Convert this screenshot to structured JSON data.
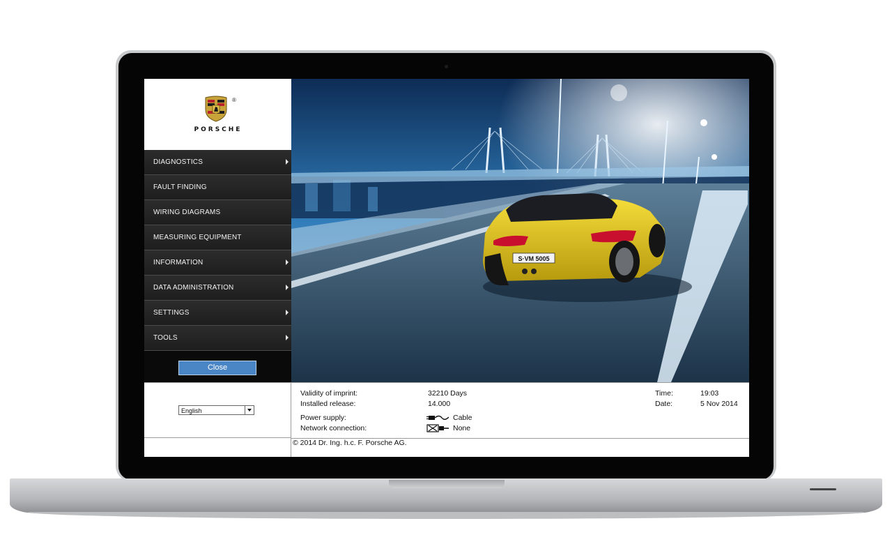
{
  "app": {
    "brand": "PORSCHE",
    "registered_mark": "®"
  },
  "menu": {
    "items": [
      {
        "label": "DIAGNOSTICS",
        "has_submenu": true
      },
      {
        "label": "FAULT FINDING",
        "has_submenu": false
      },
      {
        "label": "WIRING DIAGRAMS",
        "has_submenu": false
      },
      {
        "label": "MEASURING EQUIPMENT",
        "has_submenu": false
      },
      {
        "label": "INFORMATION",
        "has_submenu": true
      },
      {
        "label": "DATA ADMINISTRATION",
        "has_submenu": true
      },
      {
        "label": "SETTINGS",
        "has_submenu": true
      },
      {
        "label": "TOOLS",
        "has_submenu": true
      }
    ],
    "close_label": "Close"
  },
  "language": {
    "selected": "English"
  },
  "status": {
    "validity_label": "Validity of imprint:",
    "validity_value": "32210 Days",
    "release_label": "Installed release:",
    "release_value": "14.000",
    "power_label": "Power supply:",
    "power_value": "Cable",
    "network_label": "Network connection:",
    "network_value": "None",
    "time_label": "Time:",
    "time_value": "19:03",
    "date_label": "Date:",
    "date_value": "5 Nov 2014",
    "copyright": "© 2014 Dr. Ing. h.c. F. Porsche AG."
  },
  "hero": {
    "license_plate": "S·VM 5005"
  },
  "colors": {
    "accent": "#4a86c5",
    "menu_bg": "#1e1e1e",
    "car": "#e3c51c"
  }
}
